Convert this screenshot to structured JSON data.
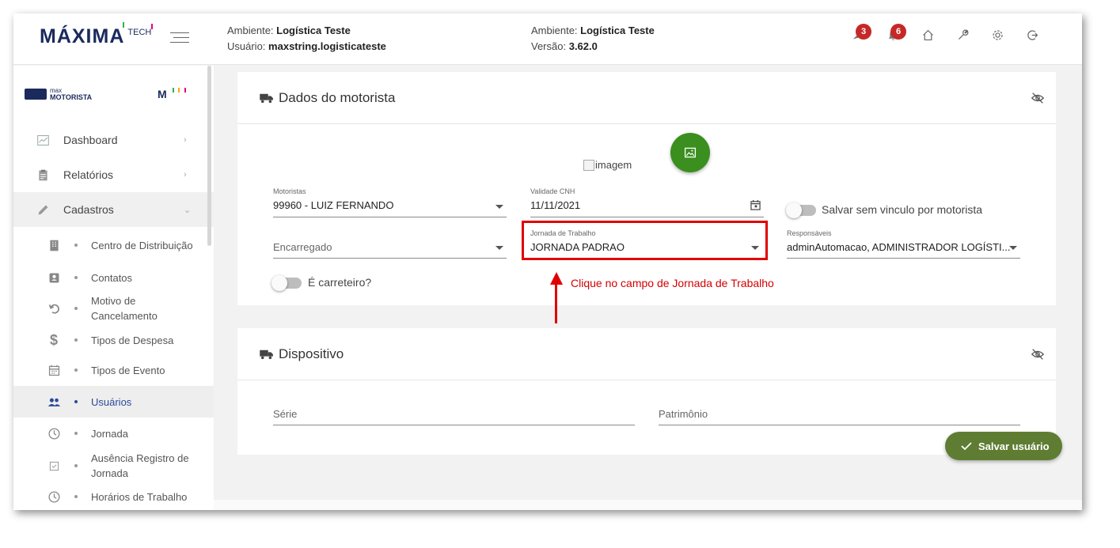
{
  "header": {
    "logo_main": "MÁXIMA",
    "logo_tech": "TECH",
    "env_left": {
      "ambiente_label": "Ambiente:",
      "ambiente_value": "Logística Teste",
      "usuario_label": "Usuário:",
      "usuario_value": "maxstring.logisticateste"
    },
    "env_right": {
      "ambiente_label": "Ambiente:",
      "ambiente_value": "Logística Teste",
      "versao_label": "Versão:",
      "versao_value": "3.62.0"
    },
    "icons": [
      {
        "name": "crow-icon",
        "badge": "3"
      },
      {
        "name": "bell-icon",
        "badge": "6"
      },
      {
        "name": "home-icon"
      },
      {
        "name": "wrench-icon"
      },
      {
        "name": "gear-icon"
      },
      {
        "name": "logout-icon"
      }
    ]
  },
  "sidebar": {
    "brand_small": "max",
    "brand_big": "MOTORISTA",
    "brand_m": "M",
    "items": [
      {
        "label": "Dashboard",
        "icon": "chart-icon",
        "chevron": "›"
      },
      {
        "label": "Relatórios",
        "icon": "clipboard-icon",
        "chevron": "›"
      },
      {
        "label": "Cadastros",
        "icon": "pencil-icon",
        "chevron": "⌄"
      }
    ],
    "subitems": [
      {
        "label": "Centro de Distribuição",
        "icon": "building-icon"
      },
      {
        "label": "Contatos",
        "icon": "contact-icon"
      },
      {
        "label": "Motivo de Cancelamento",
        "icon": "undo-icon"
      },
      {
        "label": "Tipos de Despesa",
        "icon": "dollar-icon"
      },
      {
        "label": "Tipos de Evento",
        "icon": "calendar-icon"
      },
      {
        "label": "Usuários",
        "icon": "users-icon"
      },
      {
        "label": "Jornada",
        "icon": "clock-icon"
      },
      {
        "label": "Ausência Registro de Jornada",
        "icon": "checkbox-icon"
      },
      {
        "label": "Horários de Trabalho",
        "icon": "clock-icon"
      }
    ]
  },
  "driver_card": {
    "title": "Dados do motorista",
    "image_alt": "imagem",
    "motoristas_label": "Motoristas",
    "motoristas_value": "99960 - LUIZ FERNANDO",
    "cnh_label": "Validade CNH",
    "cnh_value": "11/11/2021",
    "salvar_vinculo_label": "Salvar sem vinculo por motorista",
    "encarregado_placeholder": "Encarregado",
    "jornada_label": "Jornada de Trabalho",
    "jornada_value": "JORNADA PADRAO",
    "responsaveis_label": "Responsáveis",
    "responsaveis_value": "adminAutomacao, ADMINISTRADOR LOGÍSTI...",
    "carreteiro_label": "É carreteiro?"
  },
  "annotation": {
    "text": "Clique no campo de Jornada de Trabalho",
    "color": "#e00000"
  },
  "device_card": {
    "title": "Dispositivo",
    "serie_placeholder": "Série",
    "patrimonio_placeholder": "Patrimônio"
  },
  "actions": {
    "save_label": "Salvar usuário"
  },
  "colors": {
    "primary_green": "#3a8f1e",
    "save_green": "#5e7d33",
    "badge_red": "#c62828",
    "brand_navy": "#1a2a5c",
    "active_blue": "#2c4a9a"
  }
}
